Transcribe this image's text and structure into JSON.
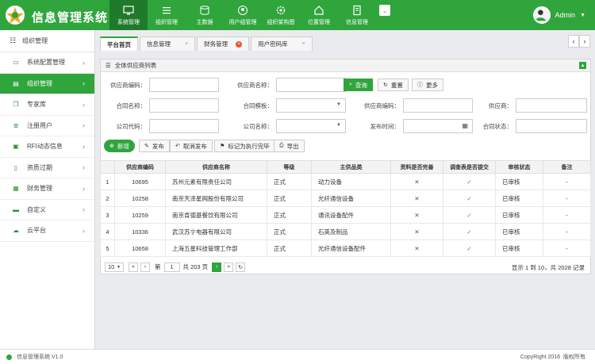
{
  "app": {
    "title": "信息管理系统",
    "footer_left": "信息管理系统 V1.0",
    "footer_copyright": "CopyRight 2016",
    "footer_rights": "版权所有"
  },
  "nav": [
    {
      "label": "系统管理",
      "active": true
    },
    {
      "label": "组织管理"
    },
    {
      "label": "主数据"
    },
    {
      "label": "用户组管理"
    },
    {
      "label": "组织架构图"
    },
    {
      "label": "位置管理"
    },
    {
      "label": "信息管理"
    }
  ],
  "user": {
    "name": "Admin"
  },
  "sidebar": {
    "header": "组织管理",
    "items": [
      {
        "label": "系统配置管理"
      },
      {
        "label": "组织管理",
        "active": true
      },
      {
        "label": "专家库"
      },
      {
        "label": "注册用户"
      },
      {
        "label": "RFI动态信息"
      },
      {
        "label": "资质过期"
      },
      {
        "label": "财务管理"
      },
      {
        "label": "自定义"
      },
      {
        "label": "云平台"
      }
    ]
  },
  "tabs": [
    "平台首页",
    "信息管理",
    "财务管理",
    "用户密码库"
  ],
  "panel": {
    "title": "全体供应商列表"
  },
  "filters": {
    "supplier_code": "供应商编码：",
    "supplier_name": "供应商名称：",
    "contract_name": "合同名称：",
    "contract_template": "合同模板：",
    "supplier_code2": "供应商编码：",
    "supplier": "供应商：",
    "company_code": "公司代码：",
    "company_name": "公司名称：",
    "publish_time": "发布时间：",
    "contract_status": "合同状态："
  },
  "buttons": {
    "query": "查询",
    "reset": "重置",
    "more": "更多",
    "add": "新增",
    "publish": "发布",
    "cancel_publish": "取消发布",
    "mark_done": "标记为执行完毕",
    "export": "导出"
  },
  "table": {
    "headers": [
      "",
      "供应商编码",
      "供应商名称",
      "等级",
      "主供品类",
      "资料是否完善",
      "调查表是否提交",
      "审核状态",
      "备注"
    ],
    "rows": [
      {
        "no": "1",
        "code": "10695",
        "name": "苏州元素有限责任公司",
        "level": "正式",
        "cat": "动力设备",
        "complete": "✕",
        "submitted": "✓",
        "status": "已审核",
        "note": "-"
      },
      {
        "no": "2",
        "code": "10258",
        "name": "南京天泽星网股份有限公司",
        "level": "正式",
        "cat": "光纤通信设备",
        "complete": "✕",
        "submitted": "✓",
        "status": "已审核",
        "note": "-"
      },
      {
        "no": "3",
        "code": "10259",
        "name": "南京肯德基餐饮有限公司",
        "level": "正式",
        "cat": "通讯设备配件",
        "complete": "✕",
        "submitted": "✓",
        "status": "已审核",
        "note": "-"
      },
      {
        "no": "4",
        "code": "10336",
        "name": "武汉苏宁电器有限公司",
        "level": "正式",
        "cat": "石英及制品",
        "complete": "✕",
        "submitted": "✓",
        "status": "已审核",
        "note": "-"
      },
      {
        "no": "5",
        "code": "10658",
        "name": "上海五星科技管理工作部",
        "level": "正式",
        "cat": "光纤通信设备配件",
        "complete": "✕",
        "submitted": "✓",
        "status": "已审核",
        "note": "-"
      }
    ]
  },
  "pager": {
    "page_size": "10",
    "page_label": "第",
    "page": "1",
    "total_pages": "共 203 页",
    "info": "显示 1 到 10，共 2028 记录"
  }
}
